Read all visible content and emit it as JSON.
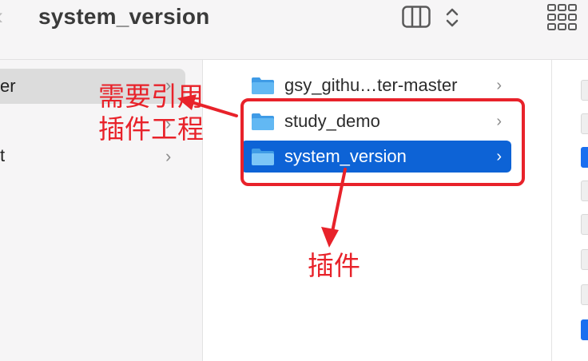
{
  "window": {
    "title": "system_version"
  },
  "toolbar": {
    "back_icon": "chevron-left-icon",
    "view_icon": "column-view-icon",
    "sort_icon": "updown-chevron-icon",
    "grid_icon": "grid-view-icon"
  },
  "sidebar_column": {
    "items": [
      {
        "label": "er",
        "selected": true
      },
      {
        "label": ""
      },
      {
        "label": "t"
      }
    ]
  },
  "folder_column": {
    "items": [
      {
        "label": "gsy_githu…ter-master",
        "selected": false,
        "icon": "folder-icon"
      },
      {
        "label": "study_demo",
        "selected": false,
        "icon": "folder-icon"
      },
      {
        "label": "system_version",
        "selected": true,
        "icon": "folder-icon"
      }
    ]
  },
  "annotations": {
    "note_line1": "需要引用",
    "note_line2": "插件工程",
    "plugin_label": "插件"
  },
  "colors": {
    "selection_blue": "#0d63d6",
    "annotation_red": "#e8222a",
    "folder_blue": "#5fb4f1"
  }
}
